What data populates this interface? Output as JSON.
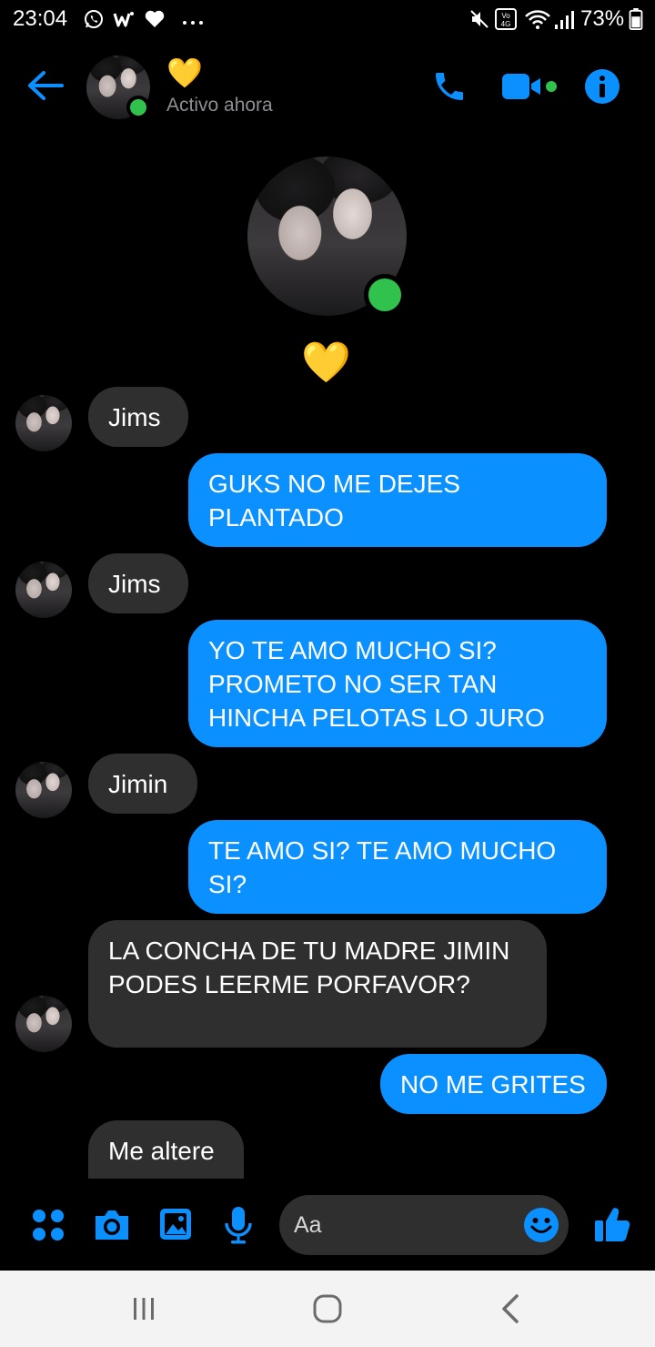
{
  "status_bar": {
    "time": "23:04",
    "notifications": [
      "whatsapp-icon",
      "wattpad-icon",
      "heart-icon",
      "more-dots-icon"
    ],
    "indicators": [
      "mute-icon",
      "volte-4g-icon",
      "wifi-icon",
      "signal-icon"
    ],
    "battery": "73%"
  },
  "header": {
    "back_icon": "arrow-left-icon",
    "name": "💛",
    "status": "Activo ahora",
    "actions": [
      "phone-icon",
      "video-camera-icon",
      "info-icon"
    ]
  },
  "profile": {
    "heart": "💛"
  },
  "messages": [
    {
      "side": "incoming",
      "text": "Jims"
    },
    {
      "side": "outgoing",
      "text": "GUKS NO ME DEJES PLANTADO"
    },
    {
      "side": "incoming",
      "text": "Jims"
    },
    {
      "side": "outgoing",
      "text": "YO TE AMO MUCHO SI? PROMETO NO SER TAN HINCHA PELOTAS LO JURO"
    },
    {
      "side": "incoming",
      "text": "Jimin"
    },
    {
      "side": "outgoing",
      "text": "TE AMO SI? TE AMO MUCHO SI?"
    },
    {
      "side": "incoming",
      "text": "LA CONCHA DE TU MADRE JIMIN PODES LEERME PORFAVOR?"
    },
    {
      "side": "outgoing",
      "text": "NO ME GRITES"
    },
    {
      "side": "incoming",
      "text": "Me altere"
    }
  ],
  "composer": {
    "placeholder": "Aa",
    "buttons": [
      "menu-dots-icon",
      "camera-icon",
      "gallery-icon",
      "microphone-icon"
    ],
    "emoji_icon": "smiley-icon",
    "like_icon": "thumbs-up-icon"
  },
  "navbar": {
    "buttons": [
      "recents-icon",
      "home-icon",
      "back-icon"
    ]
  },
  "colors": {
    "accent": "#0a91ff",
    "incoming_bubble": "#2f2f2f",
    "online": "#31c24d"
  }
}
